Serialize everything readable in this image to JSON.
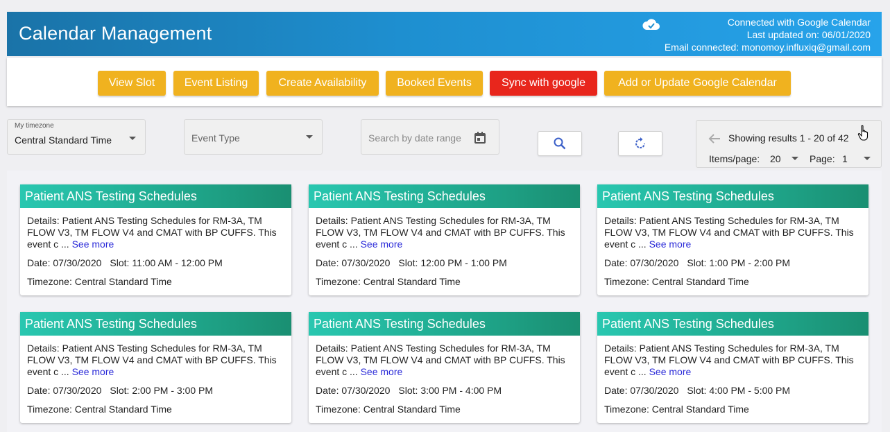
{
  "header": {
    "title": "Calendar Management",
    "connected": "Connected with Google Calendar",
    "last_updated": "Last updated on: 06/01/2020",
    "email": "Email connected: monomoy.influxiq@gmail.com",
    "icon": "cloud-check-icon"
  },
  "toolbar": {
    "buttons": [
      {
        "label": "View Slot"
      },
      {
        "label": "Event Listing"
      },
      {
        "label": "Create Availability"
      },
      {
        "label": "Booked Events"
      },
      {
        "label": "Sync with google"
      },
      {
        "label": "Add or Update Google Calendar"
      }
    ]
  },
  "filters": {
    "timezone_label": "My timezone",
    "timezone_value": "Central Standard Time",
    "event_type_placeholder": "Event Type",
    "date_range_placeholder": "Search by date range"
  },
  "pager": {
    "showing": "Showing results 1 - 20 of 42",
    "items_label": "Items/page:",
    "items_value": "20",
    "page_label": "Page:",
    "page_value": "1"
  },
  "cards": [
    {
      "title": "Patient ANS Testing Schedules",
      "details": "Details: Patient ANS Testing Schedules for RM-3A, TM FLOW V3, TM FLOW V4 and CMAT with BP CUFFS. This event c ...",
      "see_more": "See more",
      "date": "Date: 07/30/2020",
      "slot": "Slot: 11:00 AM - 12:00 PM",
      "timezone": "Timezone: Central Standard Time"
    },
    {
      "title": "Patient ANS Testing Schedules",
      "details": "Details: Patient ANS Testing Schedules for RM-3A, TM FLOW V3, TM FLOW V4 and CMAT with BP CUFFS. This event c ...",
      "see_more": "See more",
      "date": "Date: 07/30/2020",
      "slot": "Slot: 12:00 PM - 1:00 PM",
      "timezone": "Timezone: Central Standard Time"
    },
    {
      "title": "Patient ANS Testing Schedules",
      "details": "Details: Patient ANS Testing Schedules for RM-3A, TM FLOW V3, TM FLOW V4 and CMAT with BP CUFFS. This event c ...",
      "see_more": "See more",
      "date": "Date: 07/30/2020",
      "slot": "Slot: 1:00 PM - 2:00 PM",
      "timezone": "Timezone: Central Standard Time"
    },
    {
      "title": "Patient ANS Testing Schedules",
      "details": "Details: Patient ANS Testing Schedules for RM-3A, TM FLOW V3, TM FLOW V4 and CMAT with BP CUFFS. This event c ...",
      "see_more": "See more",
      "date": "Date: 07/30/2020",
      "slot": "Slot: 2:00 PM - 3:00 PM",
      "timezone": "Timezone: Central Standard Time"
    },
    {
      "title": "Patient ANS Testing Schedules",
      "details": "Details: Patient ANS Testing Schedules for RM-3A, TM FLOW V3, TM FLOW V4 and CMAT with BP CUFFS. This event c ...",
      "see_more": "See more",
      "date": "Date: 07/30/2020",
      "slot": "Slot: 3:00 PM - 4:00 PM",
      "timezone": "Timezone: Central Standard Time"
    },
    {
      "title": "Patient ANS Testing Schedules",
      "details": "Details: Patient ANS Testing Schedules for RM-3A, TM FLOW V3, TM FLOW V4 and CMAT with BP CUFFS. This event c ...",
      "see_more": "See more",
      "date": "Date: 07/30/2020",
      "slot": "Slot: 4:00 PM - 5:00 PM",
      "timezone": "Timezone: Central Standard Time"
    }
  ],
  "colors": {
    "header_start": "#1a73a8",
    "header_end": "#27a3ea",
    "button_yellow": "#f0b21f",
    "button_red": "#e8261c",
    "card_head_start": "#29c7b0",
    "card_head_end": "#1a8f72",
    "link": "#2a2ad8"
  },
  "icons": {
    "cloud": "cloud-check-icon",
    "calendar": "calendar-icon",
    "search": "search-icon",
    "refresh": "refresh-icon",
    "back_arrow": "arrow-left-icon",
    "dropdown": "chevron-down-icon",
    "cursor": "hand-pointer-icon"
  }
}
